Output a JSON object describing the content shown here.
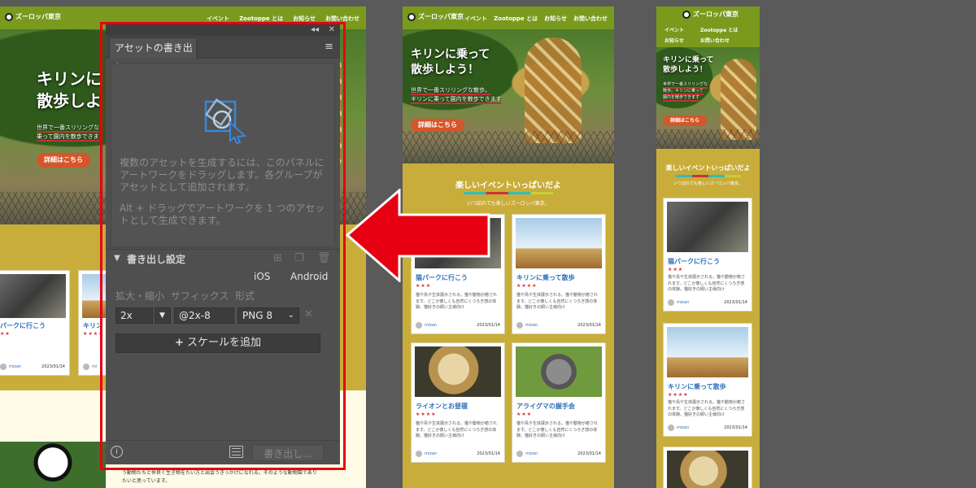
{
  "site": {
    "logo": "ズーロッパ東京",
    "nav": [
      "イベント",
      "Zootoppe とは",
      "お知らせ",
      "お問い合わせ"
    ],
    "hero_title_full": "キリンに乗って\n散歩しよう！",
    "hero_title_left": "キリンに\n散歩しよ",
    "hero_title_right": "キリンに乗って\n散歩しよう！",
    "hero_sub_full": [
      "世界で一番スリリングな散歩。",
      "キリンに乗って園内を散歩できます"
    ],
    "hero_sub_left": [
      "世界で一番スリリングな",
      "乗って園内を散歩できま"
    ],
    "hero_sub_right": [
      "世界で一番スリリングな",
      "散歩。キリンに乗って",
      "園内を散歩できます"
    ],
    "cta": "詳細はこちら",
    "section_title": "楽しいイベントいっぱいだよ",
    "section_tagline": "いつ訪れても楽しいズーロッパ東京。",
    "cards": [
      {
        "title": "猫パークに行こう",
        "stars": "★★★",
        "body": "猫や鳥や生体展示される。猫や動物が癒されます。どこか懐しくも自然にくつろぎ感の体験。猫好きの飼い主様向け",
        "author": "mizan",
        "date": "2023/01/14"
      },
      {
        "title": "キリンに乗って散歩",
        "stars": "★★★★",
        "body": "猫や鳥や生体展示される。猫や動物が癒されます。どこか懐しくも自然にくつろぎ感の体験。猫好きの飼い主様向け",
        "author": "mizan",
        "date": "2023/01/14"
      },
      {
        "title": "ライオンとお昼寝",
        "stars": "★★★★",
        "body": "猫や鳥や生体展示される。猫や動物が癒されます。どこか懐しくも自然にくつろぎ感の体験。猫好きの飼い主様向け",
        "author": "mizan",
        "date": "2023/01/14"
      },
      {
        "title": "アライグマの握手会",
        "stars": "★★★",
        "body": "猫や鳥や生体展示される。猫や動物が癒されます。どこか懐しくも自然にくつろぎ感の体験。猫好きの飼い主様向け",
        "author": "mizan",
        "date": "2023/01/14"
      }
    ],
    "left_cards": [
      {
        "title": "パークに行こう",
        "stars": "★★",
        "author": "mizan",
        "date": "2023/01/14"
      },
      {
        "title": "キリン",
        "stars": "★★★★",
        "author": "mi"
      }
    ],
    "left_bottom_text": "う動物たちと仲良く生き物をたい方と出会うきっかけになれる。そのような動物園でありたいと思っています。"
  },
  "panel": {
    "tab": "アセットの書き出し",
    "drop_msg_1": "複数のアセットを生成するには、このパネルにアートワークをドラッグします。各グループがアセットとして追加されます。",
    "drop_msg_2": "Alt + ドラッグでアートワークを 1 つのアセットとして生成できます。",
    "settings_label": "書き出し設定",
    "platform_ios": "iOS",
    "platform_android": "Android",
    "columns": "拡大・縮小 サフィックス 形式",
    "scale_value": "2x",
    "suffix_value": "@2x-8",
    "format_value": "PNG 8",
    "add_scale": "スケールを追加",
    "export_button": "書き出し...",
    "collapse_glyph": "◂◂",
    "close_glyph": "✕",
    "menu_glyph": "≡"
  },
  "colors": {
    "highlight": "#e60012",
    "site_nav": "#7a9a1e",
    "site_band": "#c9ad3a",
    "cta": "#d4562a",
    "panel_bg": "#4f4f4f"
  }
}
